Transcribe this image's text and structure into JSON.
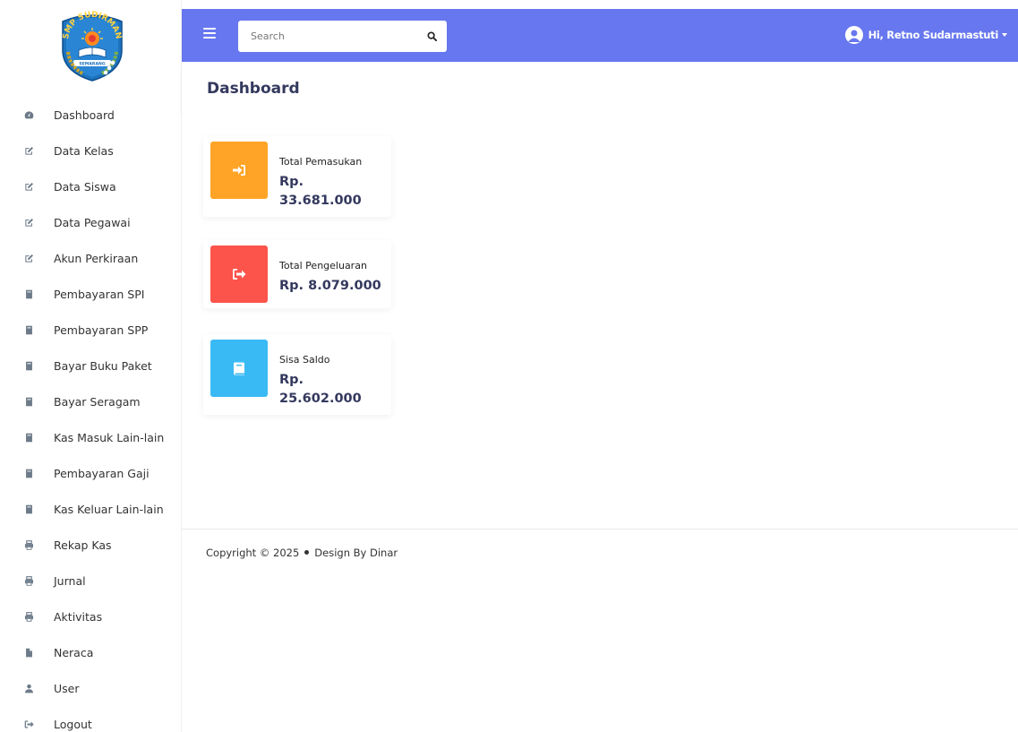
{
  "logo": {
    "top_text": "SMP SUDIRMAN",
    "banner_text": "SEMARANG"
  },
  "sidebar": {
    "items": [
      {
        "label": "Dashboard",
        "icon": "dashboard-icon"
      },
      {
        "label": "Data Kelas",
        "icon": "edit-icon"
      },
      {
        "label": "Data Siswa",
        "icon": "edit-icon"
      },
      {
        "label": "Data Pegawai",
        "icon": "edit-icon"
      },
      {
        "label": "Akun Perkiraan",
        "icon": "edit-icon"
      },
      {
        "label": "Pembayaran SPI",
        "icon": "book-icon"
      },
      {
        "label": "Pembayaran SPP",
        "icon": "book-icon"
      },
      {
        "label": "Bayar Buku Paket",
        "icon": "book-icon"
      },
      {
        "label": "Bayar Seragam",
        "icon": "book-icon"
      },
      {
        "label": "Kas Masuk Lain-lain",
        "icon": "book-icon"
      },
      {
        "label": "Pembayaran Gaji",
        "icon": "book-icon"
      },
      {
        "label": "Kas Keluar Lain-lain",
        "icon": "book-icon"
      },
      {
        "label": "Rekap Kas",
        "icon": "print-icon"
      },
      {
        "label": "Jurnal",
        "icon": "print-icon"
      },
      {
        "label": "Aktivitas",
        "icon": "print-icon"
      },
      {
        "label": "Neraca",
        "icon": "file-icon"
      },
      {
        "label": "User",
        "icon": "user-icon"
      },
      {
        "label": "Logout",
        "icon": "logout-icon"
      }
    ]
  },
  "topbar": {
    "search_placeholder": "Search",
    "user_name": "Hi, Retno Sudarmastuti"
  },
  "page": {
    "title": "Dashboard"
  },
  "cards": [
    {
      "label": "Total Pemasukan",
      "value": "Rp. 33.681.000",
      "color": "#ffa426",
      "icon": "sign-in-icon"
    },
    {
      "label": "Total Pengeluaran",
      "value": "Rp. 8.079.000",
      "color": "#fc544b",
      "icon": "sign-out-icon"
    },
    {
      "label": "Sisa Saldo",
      "value": "Rp. 25.602.000",
      "color": "#3abaf4",
      "icon": "book-icon"
    }
  ],
  "footer": {
    "copyright": "Copyright © 2025",
    "design": "Design By Dinar"
  },
  "colors": {
    "primary": "#6777ef",
    "title": "#34395e"
  }
}
